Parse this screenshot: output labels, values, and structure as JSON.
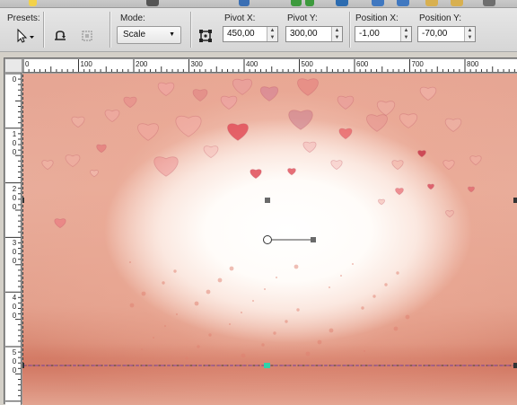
{
  "presets_label": "Presets:",
  "mode": {
    "label": "Mode:",
    "value": "Scale"
  },
  "pivot_x": {
    "label": "Pivot X:",
    "value": "450,00"
  },
  "pivot_y": {
    "label": "Pivot Y:",
    "value": "300,00"
  },
  "position_x": {
    "label": "Position X:",
    "value": "-1,00"
  },
  "position_y": {
    "label": "Position Y:",
    "value": "-70,00"
  },
  "ruler": {
    "h_labels": [
      "0",
      "100",
      "200",
      "300",
      "400",
      "500",
      "600",
      "700",
      "800"
    ],
    "v_labels": [
      [
        "0"
      ],
      [
        "1",
        "0",
        "0"
      ],
      [
        "2",
        "0",
        "0"
      ],
      [
        "3",
        "0",
        "0"
      ],
      [
        "4",
        "0",
        "0"
      ],
      [
        "5",
        "0",
        "0"
      ]
    ]
  },
  "colors": {
    "accent_handle": "#2fd3a8",
    "heart": "#e0505e"
  }
}
